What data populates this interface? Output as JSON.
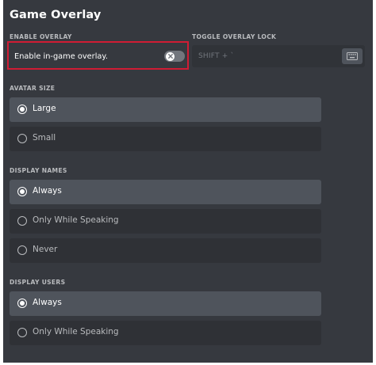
{
  "title": "Game Overlay",
  "enable_overlay": {
    "section_label": "ENABLE OVERLAY",
    "toggle_label": "Enable in-game overlay.",
    "enabled": false
  },
  "toggle_lock": {
    "section_label": "TOGGLE OVERLAY LOCK",
    "keybind": "SHIFT + `",
    "icon": "keyboard-icon"
  },
  "avatar_size": {
    "section_label": "AVATAR SIZE",
    "options": [
      {
        "label": "Large",
        "selected": true
      },
      {
        "label": "Small",
        "selected": false
      }
    ]
  },
  "display_names": {
    "section_label": "DISPLAY NAMES",
    "options": [
      {
        "label": "Always",
        "selected": true
      },
      {
        "label": "Only While Speaking",
        "selected": false
      },
      {
        "label": "Never",
        "selected": false
      }
    ]
  },
  "display_users": {
    "section_label": "DISPLAY USERS",
    "options": [
      {
        "label": "Always",
        "selected": true
      },
      {
        "label": "Only While Speaking",
        "selected": false
      }
    ]
  },
  "colors": {
    "background": "#36393f",
    "option_row": "#2f3136",
    "option_row_selected": "#4f545c",
    "highlight_border": "#d01c34"
  }
}
